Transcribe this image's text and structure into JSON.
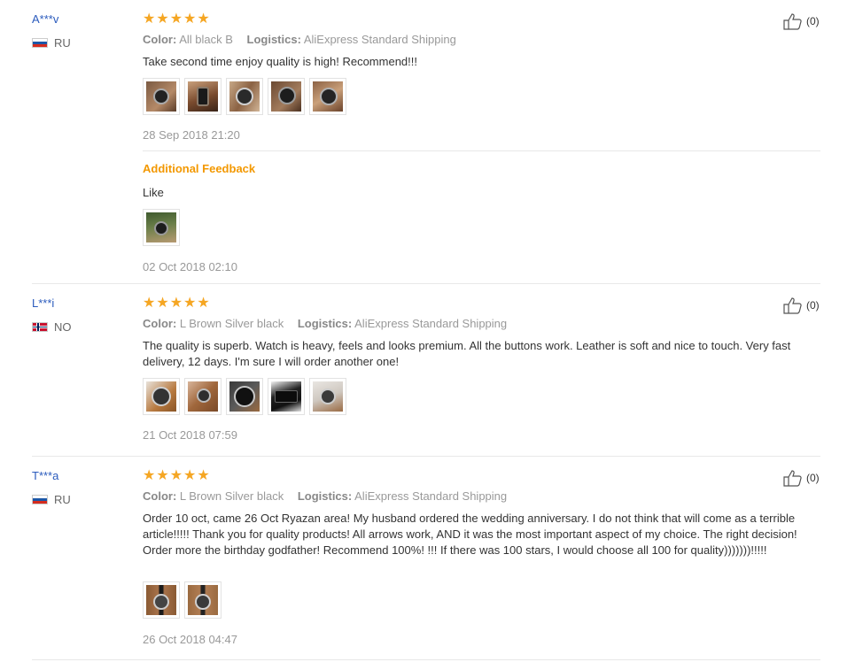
{
  "reviews": [
    {
      "user": "A***v",
      "country": "RU",
      "stars": 5,
      "color_label": "Color:",
      "color_value": "All black B",
      "logistics_label": "Logistics:",
      "logistics_value": "AliExpress Standard Shipping",
      "text": "Take second time enjoy quality is high! Recommend!!!",
      "photos": [
        "photo-1",
        "photo-2",
        "photo-3",
        "photo-4",
        "photo-5"
      ],
      "date": "28 Sep 2018 21:20",
      "helpful": "(0)",
      "additional": {
        "title": "Additional Feedback",
        "text": "Like",
        "photos": [
          "photo-1"
        ],
        "date": "02 Oct 2018 02:10"
      }
    },
    {
      "user": "L***i",
      "country": "NO",
      "stars": 5,
      "color_label": "Color:",
      "color_value": "L Brown Silver black",
      "logistics_label": "Logistics:",
      "logistics_value": "AliExpress Standard Shipping",
      "text": "The quality is superb. Watch is heavy, feels and looks premium. All the buttons work. Leather is soft and nice to touch. Very fast delivery, 12 days. I'm sure I will order another one!",
      "photos": [
        "photo-1",
        "photo-2",
        "photo-3",
        "photo-4",
        "photo-5"
      ],
      "date": "21 Oct 2018 07:59",
      "helpful": "(0)"
    },
    {
      "user": "T***a",
      "country": "RU",
      "stars": 5,
      "color_label": "Color:",
      "color_value": "L Brown Silver black",
      "logistics_label": "Logistics:",
      "logistics_value": "AliExpress Standard Shipping",
      "text": "Order 10 oct, came 26 Oct Ryazan area! My husband ordered the wedding anniversary. I do not think that will come as a terrible article!!!!! Thank you for quality products! All arrows work, AND it was the most important aspect of my choice. The right decision! Order more the birthday godfather! Recommend 100%! !!! If there was 100 stars, I would choose all 100 for quality)))))))!!!!!",
      "photos": [
        "photo-1",
        "photo-2"
      ],
      "date": "26 Oct 2018 04:47",
      "helpful": "(0)"
    }
  ],
  "colors": {
    "star": "#f5a623",
    "user": "#2b5bbd",
    "additional": "#f39800"
  },
  "icons": {
    "star": "star-icon",
    "helpful": "thumbs-up-icon"
  }
}
